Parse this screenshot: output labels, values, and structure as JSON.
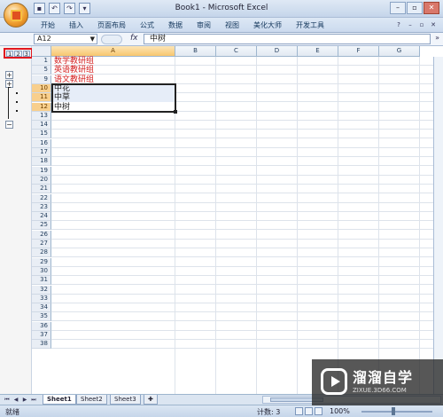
{
  "window": {
    "title": "Book1 - Microsoft Excel"
  },
  "ribbon": {
    "tabs": [
      "开始",
      "插入",
      "页面布局",
      "公式",
      "数据",
      "审阅",
      "视图",
      "美化大师",
      "开发工具"
    ]
  },
  "formula_bar": {
    "name_box": "A12",
    "fx_label": "fx",
    "content": "中树"
  },
  "outline": {
    "levels": [
      "1",
      "2",
      "3"
    ]
  },
  "columns": [
    "A",
    "B",
    "C",
    "D",
    "E",
    "F",
    "G"
  ],
  "rows": [
    {
      "num": "1",
      "a": "数学教研组",
      "color": "red"
    },
    {
      "num": "5",
      "a": "英语教研组",
      "color": "red"
    },
    {
      "num": "9",
      "a": "语文教研组",
      "color": "red"
    },
    {
      "num": "10",
      "a": "中花",
      "color": "black",
      "selected": true
    },
    {
      "num": "11",
      "a": "中草",
      "color": "black",
      "selected": true
    },
    {
      "num": "12",
      "a": "中树",
      "color": "black",
      "selected": true
    },
    {
      "num": "13"
    },
    {
      "num": "14"
    },
    {
      "num": "15"
    },
    {
      "num": "16"
    },
    {
      "num": "17"
    },
    {
      "num": "18"
    },
    {
      "num": "19"
    },
    {
      "num": "20"
    },
    {
      "num": "21"
    },
    {
      "num": "22"
    },
    {
      "num": "23"
    },
    {
      "num": "24"
    },
    {
      "num": "25"
    },
    {
      "num": "26"
    },
    {
      "num": "27"
    },
    {
      "num": "28"
    },
    {
      "num": "29"
    },
    {
      "num": "30"
    },
    {
      "num": "31"
    },
    {
      "num": "32"
    },
    {
      "num": "33"
    },
    {
      "num": "34"
    },
    {
      "num": "35"
    },
    {
      "num": "36"
    },
    {
      "num": "37"
    },
    {
      "num": "38"
    }
  ],
  "sheets": [
    "Sheet1",
    "Sheet2",
    "Sheet3"
  ],
  "active_sheet": "Sheet1",
  "status": {
    "ready": "就绪",
    "count": "计数: 3",
    "zoom": "100%"
  },
  "watermark": {
    "title": "溜溜自学",
    "sub": "ZIXUE.3D66.COM"
  },
  "colors": {
    "selection_header": "#f8cf8d",
    "red_text": "#d42020",
    "outline_highlight": "#e0171f"
  }
}
